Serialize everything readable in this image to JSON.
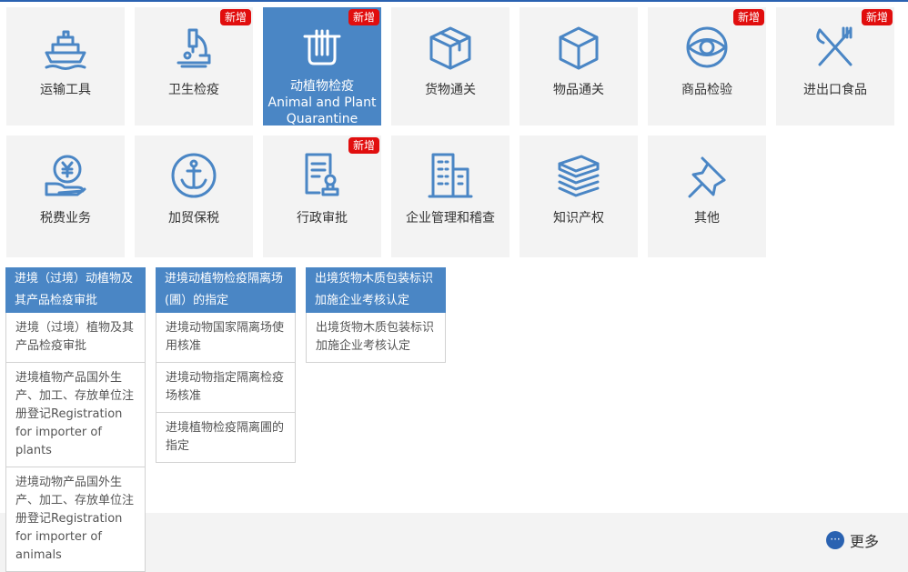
{
  "tiles": [
    {
      "label": "运输工具",
      "icon": "ship-icon",
      "badge": ""
    },
    {
      "label": "卫生检疫",
      "icon": "microscope-icon",
      "badge": "新增"
    },
    {
      "label": "动植物检疫 Animal and Plant Quarantine",
      "icon": "test-tubes-icon",
      "badge": "新增"
    },
    {
      "label": "货物通关",
      "icon": "box-icon",
      "badge": ""
    },
    {
      "label": "物品通关",
      "icon": "cube-icon",
      "badge": ""
    },
    {
      "label": "商品检验",
      "icon": "eye-icon",
      "badge": "新增"
    },
    {
      "label": "进出口食品",
      "icon": "fork-knife-icon",
      "badge": "新增"
    },
    {
      "label": "税费业务",
      "icon": "yuan-hand-icon",
      "badge": ""
    },
    {
      "label": "加贸保税",
      "icon": "anchor-icon",
      "badge": ""
    },
    {
      "label": "行政审批",
      "icon": "document-stamp-icon",
      "badge": "新增"
    },
    {
      "label": "企业管理和稽查",
      "icon": "building-icon",
      "badge": ""
    },
    {
      "label": "知识产权",
      "icon": "books-icon",
      "badge": ""
    },
    {
      "label": "其他",
      "icon": "pushpin-icon",
      "badge": ""
    }
  ],
  "columns": [
    {
      "header": "进境（过境）动植物及其产品检疫审批",
      "items": [
        "进境（过境）植物及其产品检疫审批",
        "进境植物产品国外生产、加工、存放单位注册登记Registration for importer of plants",
        "进境动物产品国外生产、加工、存放单位注册登记Registration for importer of animals"
      ]
    },
    {
      "header": "进境动植物检疫隔离场(圃）的指定",
      "items": [
        "进境动物国家隔离场使用核准",
        "进境动物指定隔离检疫场核准",
        "进境植物检疫隔离圃的指定"
      ]
    },
    {
      "header": "出境货物木质包装标识加施企业考核认定",
      "items": [
        "出境货物木质包装标识加施企业考核认定"
      ]
    }
  ],
  "more": {
    "label": "更多",
    "icon": "ellipsis-icon"
  },
  "colors": {
    "accent": "#4a86c5",
    "badge": "#e10e0e",
    "tile_bg": "#f3f3f3"
  }
}
